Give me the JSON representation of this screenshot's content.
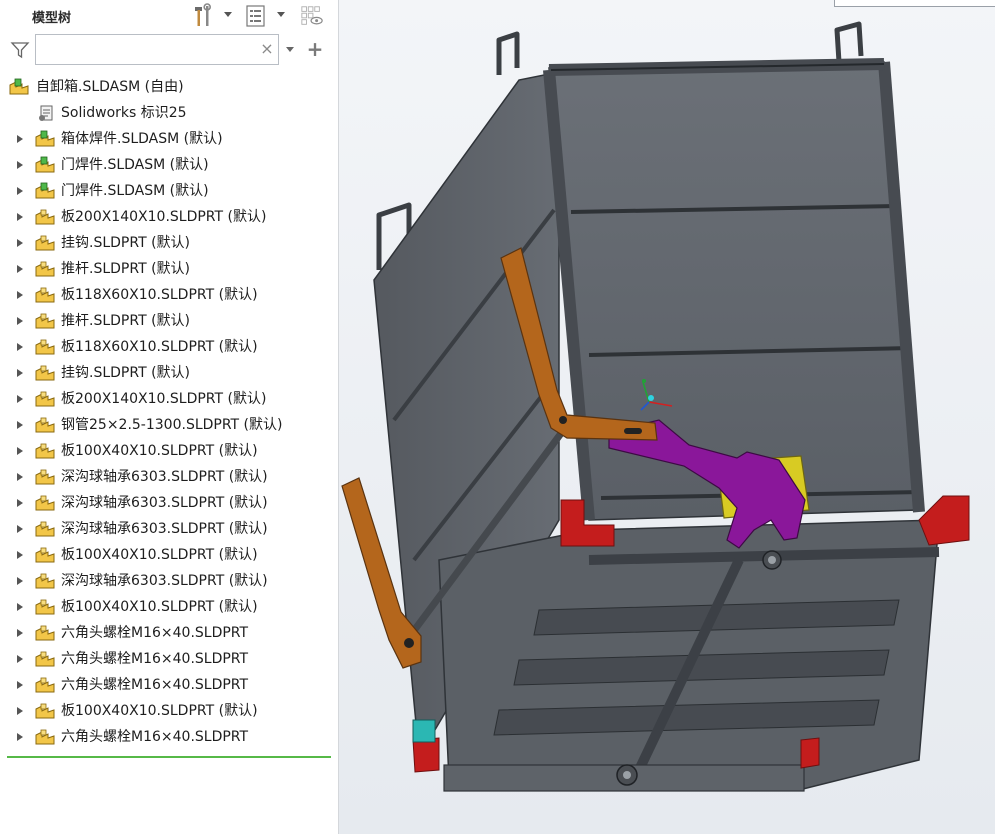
{
  "panel": {
    "title": "模型树",
    "search_value": "",
    "clear_label": "×",
    "add_label": "+"
  },
  "tree": {
    "root": {
      "label": "自卸箱.SLDASM (自由)",
      "icon": "assembly-icon"
    },
    "items": [
      {
        "label": "Solidworks 标识25",
        "icon": "annotation-icon",
        "expandable": false
      },
      {
        "label": "箱体焊件.SLDASM (默认)",
        "icon": "assembly-icon",
        "expandable": true
      },
      {
        "label": "门焊件.SLDASM (默认)",
        "icon": "assembly-icon",
        "expandable": true
      },
      {
        "label": "门焊件.SLDASM (默认)",
        "icon": "assembly-icon",
        "expandable": true
      },
      {
        "label": "板200X140X10.SLDPRT (默认)",
        "icon": "part-icon",
        "expandable": true
      },
      {
        "label": "挂钩.SLDPRT (默认)",
        "icon": "part-icon",
        "expandable": true
      },
      {
        "label": "推杆.SLDPRT (默认)",
        "icon": "part-icon",
        "expandable": true
      },
      {
        "label": "板118X60X10.SLDPRT (默认)",
        "icon": "part-icon",
        "expandable": true
      },
      {
        "label": "推杆.SLDPRT (默认)",
        "icon": "part-icon",
        "expandable": true
      },
      {
        "label": "板118X60X10.SLDPRT (默认)",
        "icon": "part-icon",
        "expandable": true
      },
      {
        "label": "挂钩.SLDPRT (默认)",
        "icon": "part-icon",
        "expandable": true
      },
      {
        "label": "板200X140X10.SLDPRT (默认)",
        "icon": "part-icon",
        "expandable": true
      },
      {
        "label": "钢管25×2.5-1300.SLDPRT (默认)",
        "icon": "part-icon",
        "expandable": true
      },
      {
        "label": "板100X40X10.SLDPRT (默认)",
        "icon": "part-icon",
        "expandable": true
      },
      {
        "label": "深沟球轴承6303.SLDPRT (默认)",
        "icon": "part-icon",
        "expandable": true
      },
      {
        "label": "深沟球轴承6303.SLDPRT (默认)",
        "icon": "part-icon",
        "expandable": true
      },
      {
        "label": "深沟球轴承6303.SLDPRT (默认)",
        "icon": "part-icon",
        "expandable": true
      },
      {
        "label": "板100X40X10.SLDPRT (默认)",
        "icon": "part-icon",
        "expandable": true
      },
      {
        "label": "深沟球轴承6303.SLDPRT (默认)",
        "icon": "part-icon",
        "expandable": true
      },
      {
        "label": "板100X40X10.SLDPRT (默认)",
        "icon": "part-icon",
        "expandable": true
      },
      {
        "label": "六角头螺栓M16×40.SLDPRT",
        "icon": "part-icon",
        "expandable": true
      },
      {
        "label": "六角头螺栓M16×40.SLDPRT",
        "icon": "part-icon",
        "expandable": true
      },
      {
        "label": "六角头螺栓M16×40.SLDPRT",
        "icon": "part-icon",
        "expandable": true
      },
      {
        "label": "板100X40X10.SLDPRT (默认)",
        "icon": "part-icon",
        "expandable": true
      },
      {
        "label": "六角头螺栓M16×40.SLDPRT",
        "icon": "part-icon",
        "expandable": true
      }
    ]
  },
  "toolbar": {
    "tools_icon": "hammer-wrench-icon",
    "list_icon": "tree-list-icon",
    "display_icon": "show-hide-icon",
    "filter_icon": "filter-icon"
  },
  "colors": {
    "accent_line": "#56b947",
    "model_body": "#5c6168",
    "orange_arm": "#b4661c",
    "purple_plate": "#8a179a",
    "yellow_plate": "#d8cb23",
    "red_corner": "#c41d1d"
  }
}
